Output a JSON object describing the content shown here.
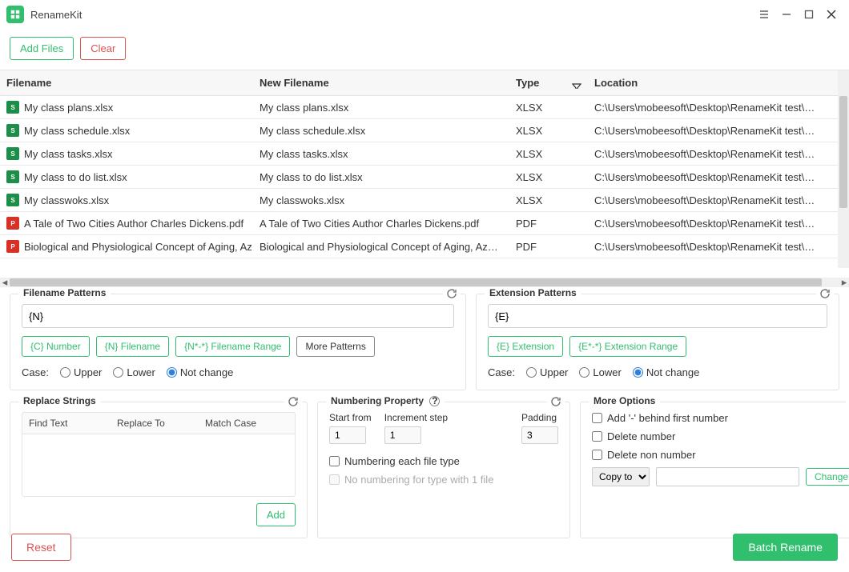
{
  "app": {
    "title": "RenameKit"
  },
  "toolbar": {
    "add_files": "Add Files",
    "clear": "Clear"
  },
  "table": {
    "headers": {
      "filename": "Filename",
      "new_filename": "New Filename",
      "type": "Type",
      "location": "Location"
    },
    "rows": [
      {
        "icon": "xlsx",
        "filename": "My class plans.xlsx",
        "new_filename": "My class plans.xlsx",
        "type": "XLSX",
        "location": "C:\\Users\\mobeesoft\\Desktop\\RenameKit test\\Sheets"
      },
      {
        "icon": "xlsx",
        "filename": "My class schedule.xlsx",
        "new_filename": "My class schedule.xlsx",
        "type": "XLSX",
        "location": "C:\\Users\\mobeesoft\\Desktop\\RenameKit test\\Sheets"
      },
      {
        "icon": "xlsx",
        "filename": "My class tasks.xlsx",
        "new_filename": "My class tasks.xlsx",
        "type": "XLSX",
        "location": "C:\\Users\\mobeesoft\\Desktop\\RenameKit test\\Sheets"
      },
      {
        "icon": "xlsx",
        "filename": "My class to do list.xlsx",
        "new_filename": "My class to do list.xlsx",
        "type": "XLSX",
        "location": "C:\\Users\\mobeesoft\\Desktop\\RenameKit test\\Sheets"
      },
      {
        "icon": "xlsx",
        "filename": "My classwoks.xlsx",
        "new_filename": "My classwoks.xlsx",
        "type": "XLSX",
        "location": "C:\\Users\\mobeesoft\\Desktop\\RenameKit test\\Sheets"
      },
      {
        "icon": "pdf",
        "filename": "A Tale of Two Cities Author Charles Dickens.pdf",
        "new_filename": "A Tale of Two Cities Author Charles Dickens.pdf",
        "type": "PDF",
        "location": "C:\\Users\\mobeesoft\\Desktop\\RenameKit test\\PDFs"
      },
      {
        "icon": "pdf",
        "filename": "Biological and Physiological Concept of Aging, Az",
        "new_filename": "Biological and Physiological Concept of Aging, Azza S.",
        "type": "PDF",
        "location": "C:\\Users\\mobeesoft\\Desktop\\RenameKit test\\PDFs"
      }
    ]
  },
  "filename_patterns": {
    "title": "Filename Patterns",
    "value": "{N}",
    "chips": {
      "c_number": "{C} Number",
      "n_filename": "{N} Filename",
      "n_range": "{N*-*} Filename Range",
      "more": "More Patterns"
    },
    "case_label": "Case:",
    "upper": "Upper",
    "lower": "Lower",
    "not_change": "Not change"
  },
  "extension_patterns": {
    "title": "Extension Patterns",
    "value": "{E}",
    "chips": {
      "e_ext": "{E} Extension",
      "e_range": "{E*-*} Extension Range"
    },
    "case_label": "Case:",
    "upper": "Upper",
    "lower": "Lower",
    "not_change": "Not change"
  },
  "replace": {
    "title": "Replace Strings",
    "find": "Find Text",
    "replace_to": "Replace To",
    "match_case": "Match Case",
    "add": "Add"
  },
  "numbering": {
    "title": "Numbering Property",
    "start_from": "Start from",
    "start_val": "1",
    "increment": "Increment step",
    "inc_val": "1",
    "padding": "Padding",
    "pad_val": "3",
    "each_type": "Numbering each file type",
    "no_number_one": "No numbering for type with 1 file"
  },
  "more": {
    "title": "More Options",
    "add_dash": "Add '-' behind first number",
    "delete_number": "Delete number",
    "delete_non_number": "Delete non number",
    "copy_to": "Copy to",
    "change": "Change"
  },
  "footer": {
    "reset": "Reset",
    "batch": "Batch Rename"
  }
}
